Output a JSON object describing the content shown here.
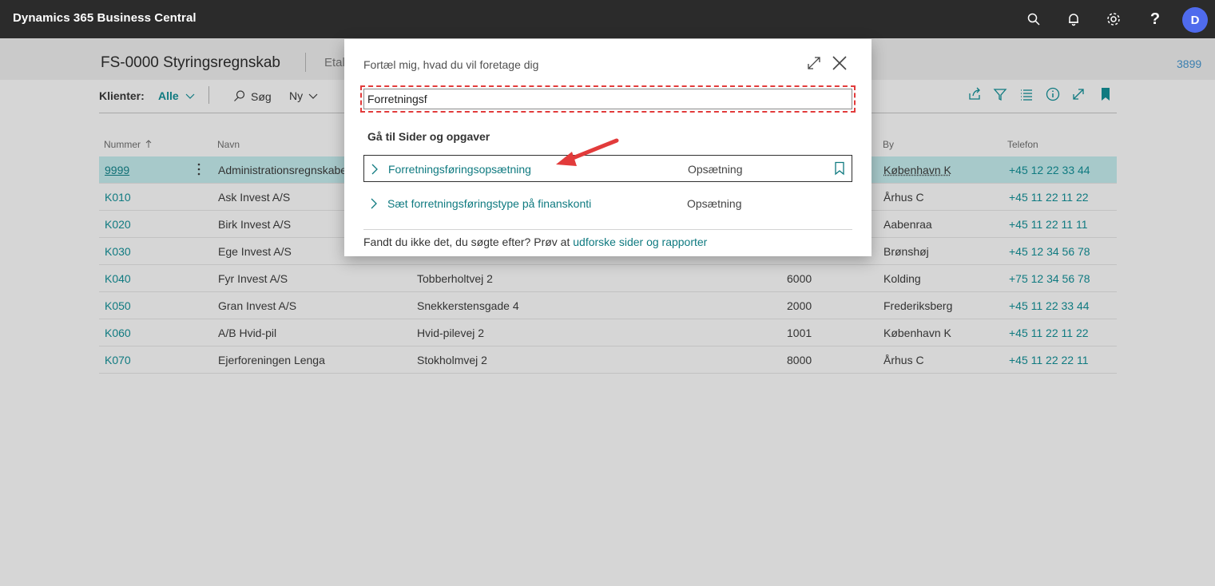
{
  "topbar": {
    "app_title": "Dynamics 365 Business Central",
    "avatar_initial": "D",
    "help_label": "?"
  },
  "page": {
    "title": "FS-0000 Styringsregnskab",
    "title_extra": "Etal",
    "top_right_value": "3899",
    "actions": {
      "clients_label": "Klienter:",
      "clients_value": "Alle",
      "search_label": "Søg",
      "new_label": "Ny"
    },
    "grid": {
      "headers": {
        "number": "Nummer",
        "name": "Navn",
        "city": "By",
        "phone": "Telefon"
      },
      "rows": [
        {
          "number": "9999",
          "name": "Administrationsregnskabet",
          "address": "",
          "postcode": "",
          "city": "København K",
          "phone": "+45 12 22 33 44"
        },
        {
          "number": "K010",
          "name": "Ask Invest A/S",
          "address": "",
          "postcode": "",
          "city": "Århus C",
          "phone": "+45 11 22 11 22"
        },
        {
          "number": "K020",
          "name": "Birk Invest A/S",
          "address": "",
          "postcode": "",
          "city": "Aabenraa",
          "phone": "+45 11 22 11 11"
        },
        {
          "number": "K030",
          "name": "Ege Invest A/S",
          "address": "",
          "postcode": "",
          "city": "Brønshøj",
          "phone": "+45 12 34 56 78"
        },
        {
          "number": "K040",
          "name": "Fyr Invest A/S",
          "address": "Tobberholtvej 2",
          "postcode": "6000",
          "city": "Kolding",
          "phone": "+75 12 34 56 78"
        },
        {
          "number": "K050",
          "name": "Gran Invest A/S",
          "address": "Snekkerstensgade 4",
          "postcode": "2000",
          "city": "Frederiksberg",
          "phone": "+45 11 22 33 44"
        },
        {
          "number": "K060",
          "name": "A/B Hvid-pil",
          "address": "Hvid-pilevej 2",
          "postcode": "1001",
          "city": "København K",
          "phone": "+45 11 22 11 22"
        },
        {
          "number": "K070",
          "name": "Ejerforeningen Lenga",
          "address": "Stokholmvej 2",
          "postcode": "8000",
          "city": "Århus C",
          "phone": "+45 11 22 22 11"
        }
      ]
    }
  },
  "dialog": {
    "title": "Fortæl mig, hvad du vil foretage dig",
    "search_value": "Forretningsf",
    "section_title": "Gå til Sider og opgaver",
    "results": [
      {
        "name": "Forretningsføringsopsætning",
        "category": "Opsætning"
      },
      {
        "name": "Sæt forretningsføringstype på finanskonti",
        "category": "Opsætning"
      }
    ],
    "footer_text": "Fandt du ikke det, du søgte efter? Prøv at ",
    "footer_link": "udforske sider og rapporter"
  },
  "colors": {
    "topbar": "#2b2b2b",
    "accent_teal": "#0f7a80",
    "avatar": "#4f6bed",
    "annotation_red": "#e23b3b",
    "selected_row": "#a7c9ca"
  }
}
